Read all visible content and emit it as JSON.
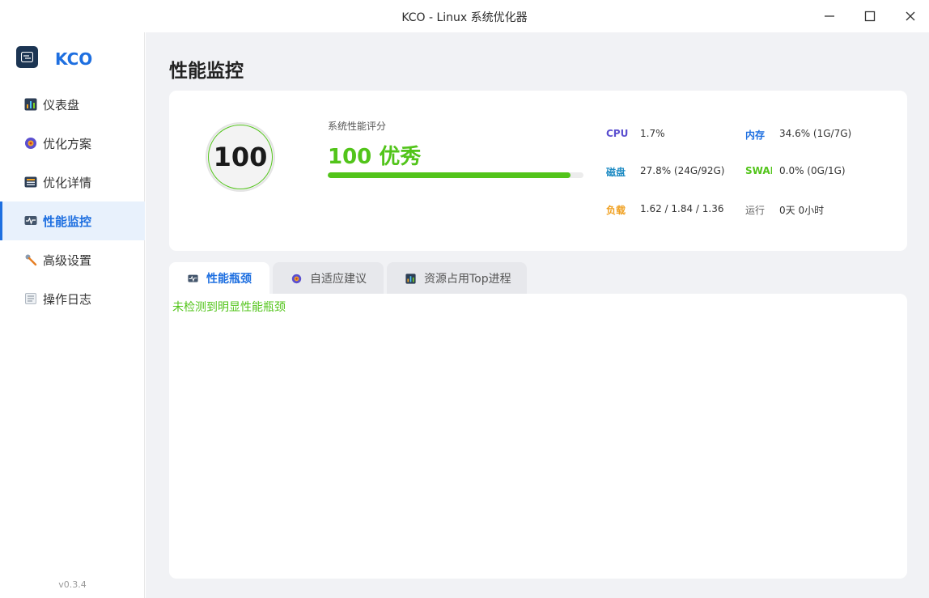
{
  "window": {
    "title": "KCO - Linux 系统优化器"
  },
  "brand": {
    "name": "KCO",
    "version": "v0.3.4"
  },
  "sidebar": {
    "items": [
      {
        "label": "仪表盘",
        "icon": "dashboard-icon"
      },
      {
        "label": "优化方案",
        "icon": "plan-icon"
      },
      {
        "label": "优化详情",
        "icon": "details-icon"
      },
      {
        "label": "性能监控",
        "icon": "monitor-icon",
        "active": true
      },
      {
        "label": "高级设置",
        "icon": "wrench-icon"
      },
      {
        "label": "操作日志",
        "icon": "log-icon"
      }
    ]
  },
  "page": {
    "title": "性能监控"
  },
  "score": {
    "value": "100",
    "label": "系统性能评分",
    "text": "100  优秀",
    "bar_fraction": 0.95,
    "color": "#52c41a"
  },
  "metrics": {
    "cpu": {
      "label": "CPU",
      "value": "1.7%",
      "color": "#5b4fcf"
    },
    "mem": {
      "label": "内存",
      "value": "34.6%  (1G/7G)",
      "color": "#1e6fe0"
    },
    "disk": {
      "label": "磁盘",
      "value": "27.8%  (24G/92G)",
      "color": "#1e8bc3"
    },
    "swap": {
      "label": "SWAP",
      "value": "0.0%  (0G/1G)",
      "color": "#52c41a"
    },
    "load": {
      "label": "负载",
      "value": "1.62  /  1.84  /  1.36",
      "color": "#f0a020"
    },
    "uptime": {
      "label": "运行",
      "value": "0天 0小时",
      "color": "#666666"
    }
  },
  "tabs": [
    {
      "label": "性能瓶颈",
      "icon": "bottleneck-icon",
      "active": true
    },
    {
      "label": "自适应建议",
      "icon": "suggestion-icon"
    },
    {
      "label": "资源占用Top进程",
      "icon": "top-process-icon"
    }
  ],
  "panel": {
    "message": "未检测到明显性能瓶颈"
  }
}
